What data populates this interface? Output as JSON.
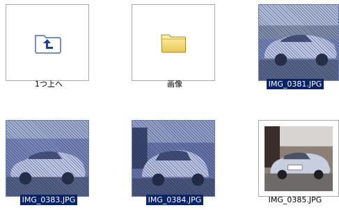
{
  "items": [
    {
      "label": "1つ上へ",
      "icon": "folder-up-icon",
      "selected": false
    },
    {
      "label": "画像",
      "icon": "folder-icon",
      "selected": false
    },
    {
      "label": "IMG_0381.JPG",
      "icon": "photo-thumbnail",
      "selected": true
    },
    {
      "label": "IMG_0383.JPG",
      "icon": "photo-thumbnail",
      "selected": true
    },
    {
      "label": "IMG_0384.JPG",
      "icon": "photo-thumbnail",
      "selected": true
    },
    {
      "label": "IMG_0385.JPG",
      "icon": "photo-thumbnail",
      "selected": false
    }
  ],
  "colors": {
    "selection": "#0a246a",
    "folder": "#f2e07a",
    "thumb_border": "#a9a9a9"
  }
}
